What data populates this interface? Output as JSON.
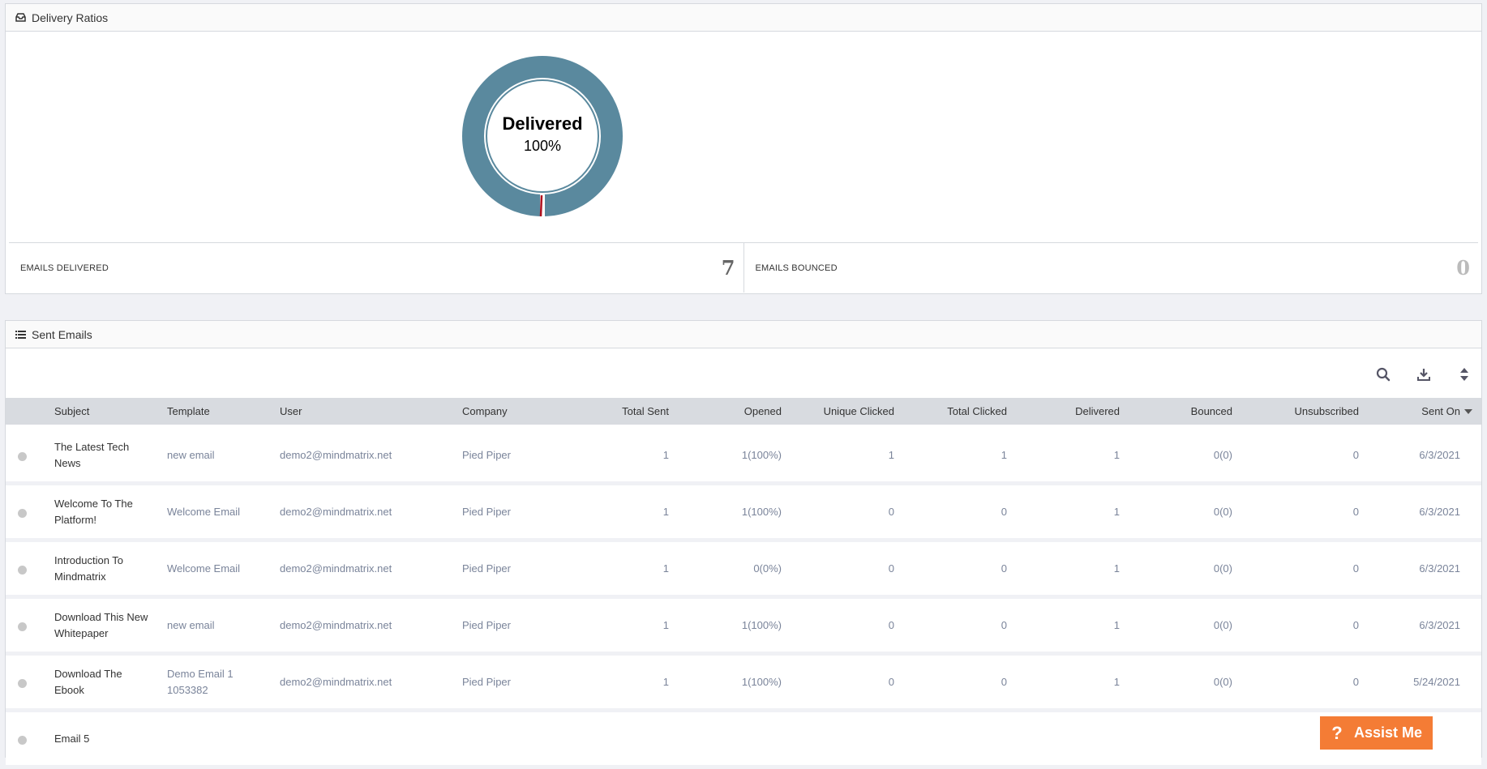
{
  "delivery": {
    "title": "Delivery Ratios",
    "donut_label": "Delivered",
    "donut_percent": "100%",
    "delivered_fraction": 1.0,
    "colors": {
      "delivered": "#5a899e",
      "bounced": "#b0101e"
    },
    "stats": [
      {
        "label": "EMAILS DELIVERED",
        "value": "7"
      },
      {
        "label": "EMAILS BOUNCED",
        "value": "0"
      }
    ]
  },
  "sent": {
    "title": "Sent Emails",
    "columns": [
      "Subject",
      "Template",
      "User",
      "Company",
      "Total Sent",
      "Opened",
      "Unique Clicked",
      "Total Clicked",
      "Delivered",
      "Bounced",
      "Unsubscribed",
      "Sent On"
    ],
    "rows": [
      {
        "subject": "The Latest Tech News",
        "template": "new email",
        "user": "demo2@mindmatrix.net",
        "company": "Pied Piper",
        "total_sent": "1",
        "opened": "1(100%)",
        "unique_clicked": "1",
        "total_clicked": "1",
        "delivered": "1",
        "bounced": "0(0)",
        "unsubscribed": "0",
        "sent_on": "6/3/2021"
      },
      {
        "subject": "Welcome To The Platform!",
        "template": "Welcome Email",
        "user": "demo2@mindmatrix.net",
        "company": "Pied Piper",
        "total_sent": "1",
        "opened": "1(100%)",
        "unique_clicked": "0",
        "total_clicked": "0",
        "delivered": "1",
        "bounced": "0(0)",
        "unsubscribed": "0",
        "sent_on": "6/3/2021"
      },
      {
        "subject": "Introduction To Mindmatrix",
        "template": "Welcome Email",
        "user": "demo2@mindmatrix.net",
        "company": "Pied Piper",
        "total_sent": "1",
        "opened": "0(0%)",
        "unique_clicked": "0",
        "total_clicked": "0",
        "delivered": "1",
        "bounced": "0(0)",
        "unsubscribed": "0",
        "sent_on": "6/3/2021"
      },
      {
        "subject": "Download This New Whitepaper",
        "template": "new email",
        "user": "demo2@mindmatrix.net",
        "company": "Pied Piper",
        "total_sent": "1",
        "opened": "1(100%)",
        "unique_clicked": "0",
        "total_clicked": "0",
        "delivered": "1",
        "bounced": "0(0)",
        "unsubscribed": "0",
        "sent_on": "6/3/2021"
      },
      {
        "subject": "Download The Ebook",
        "template": "Demo Email 1 1053382",
        "user": "demo2@mindmatrix.net",
        "company": "Pied Piper",
        "total_sent": "1",
        "opened": "1(100%)",
        "unique_clicked": "0",
        "total_clicked": "0",
        "delivered": "1",
        "bounced": "0(0)",
        "unsubscribed": "0",
        "sent_on": "5/24/2021"
      },
      {
        "subject": "Email 5",
        "template": "",
        "user": "",
        "company": "",
        "total_sent": "",
        "opened": "",
        "unique_clicked": "",
        "total_clicked": "",
        "delivered": "",
        "bounced": "",
        "unsubscribed": "",
        "sent_on": ""
      }
    ],
    "toolbar_icons": [
      "search-icon",
      "download-icon",
      "sort-icon"
    ]
  },
  "assist": {
    "label": "Assist Me",
    "glyph": "?"
  }
}
